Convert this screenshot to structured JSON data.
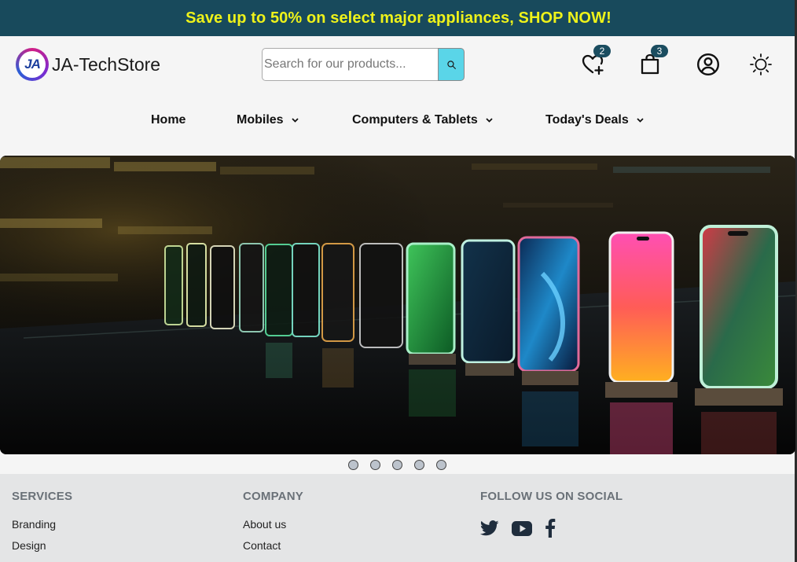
{
  "promo": {
    "text": "Save up to 50% on select major appliances, SHOP NOW!"
  },
  "brand": {
    "logo_letters": "JA",
    "name": "JA-TechStore"
  },
  "search": {
    "placeholder": "Search for our products..."
  },
  "header_icons": {
    "wishlist": {
      "icon": "heart-plus-icon",
      "count": "2"
    },
    "cart": {
      "icon": "shopping-bag-icon",
      "count": "3"
    },
    "account": {
      "icon": "user-circle-icon"
    },
    "theme": {
      "icon": "sun-icon"
    }
  },
  "nav": {
    "home": "Home",
    "mobiles": "Mobiles",
    "computers": "Computers & Tablets",
    "deals": "Today's Deals"
  },
  "carousel": {
    "slide_count": 5
  },
  "footer": {
    "services": {
      "heading": "SERVICES",
      "links": [
        "Branding",
        "Design"
      ]
    },
    "company": {
      "heading": "COMPANY",
      "links": [
        "About us",
        "Contact"
      ]
    },
    "social": {
      "heading": "FOLLOW US ON SOCIAL",
      "icons": [
        "twitter-icon",
        "youtube-icon",
        "facebook-icon"
      ]
    }
  },
  "colors": {
    "promo_bg": "#184a5c",
    "promo_text": "#eef21a",
    "accent": "#5ad5e8",
    "badge": "#1b4d60"
  }
}
